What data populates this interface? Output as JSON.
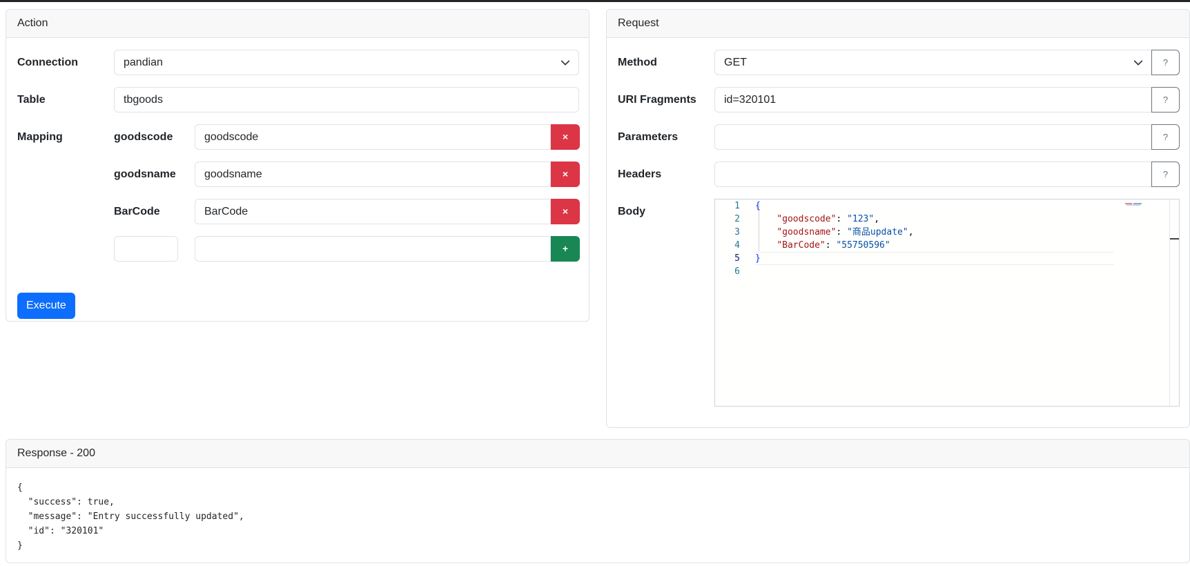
{
  "action": {
    "header": "Action",
    "connection_label": "Connection",
    "connection_value": "pandian",
    "table_label": "Table",
    "table_value": "tbgoods",
    "mapping_label": "Mapping",
    "mappings": [
      {
        "key": "goodscode",
        "value": "goodscode"
      },
      {
        "key": "goodsname",
        "value": "goodsname"
      },
      {
        "key": "BarCode",
        "value": "BarCode"
      }
    ],
    "remove_glyph": "×",
    "add_glyph": "+",
    "new_key_value": "",
    "new_value_value": "",
    "execute_label": "Execute"
  },
  "request": {
    "header": "Request",
    "method_label": "Method",
    "method_value": "GET",
    "uri_label": "URI Fragments",
    "uri_value": "id=320101",
    "params_label": "Parameters",
    "params_value": "",
    "headers_label": "Headers",
    "headers_value": "",
    "body_label": "Body",
    "help_glyph": "?",
    "body_line_numbers": [
      "1",
      "2",
      "3",
      "4",
      "5",
      "6"
    ],
    "body_lines": {
      "l1": "{",
      "l2_key": "\"goodscode\"",
      "l2_val": "\"123\"",
      "l3_key": "\"goodsname\"",
      "l3_val": "\"商品update\"",
      "l4_key": "\"BarCode\"",
      "l4_val": "\"55750596\"",
      "l5": "}"
    }
  },
  "response": {
    "header": "Response - 200",
    "body": "{\n  \"success\": true,\n  \"message\": \"Entry successfully updated\",\n  \"id\": \"320101\"\n}"
  },
  "colors": {
    "primary": "#0d6efd",
    "danger": "#dc3545",
    "success": "#198754"
  },
  "icons": {
    "select_arrow": "chevron-down-icon",
    "remove": "close-icon",
    "add": "plus-icon",
    "help": "question-icon"
  }
}
